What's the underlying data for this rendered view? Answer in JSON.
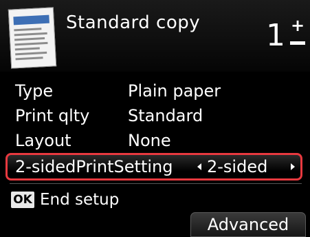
{
  "header": {
    "title": "Standard copy",
    "copies": "1",
    "icon": "document-icon"
  },
  "settings": [
    {
      "label": "Type",
      "value": "Plain paper"
    },
    {
      "label": "Print qlty",
      "value": "Standard"
    },
    {
      "label": "Layout",
      "value": "None"
    }
  ],
  "selected_setting": {
    "label": "2-sidedPrintSetting",
    "value": "2-sided"
  },
  "footer": {
    "ok_key": "OK",
    "end_setup_label": "End setup",
    "advanced_label": "Advanced"
  },
  "colors": {
    "highlight_border": "#e8393f",
    "background": "#000000",
    "text": "#ffffff"
  }
}
